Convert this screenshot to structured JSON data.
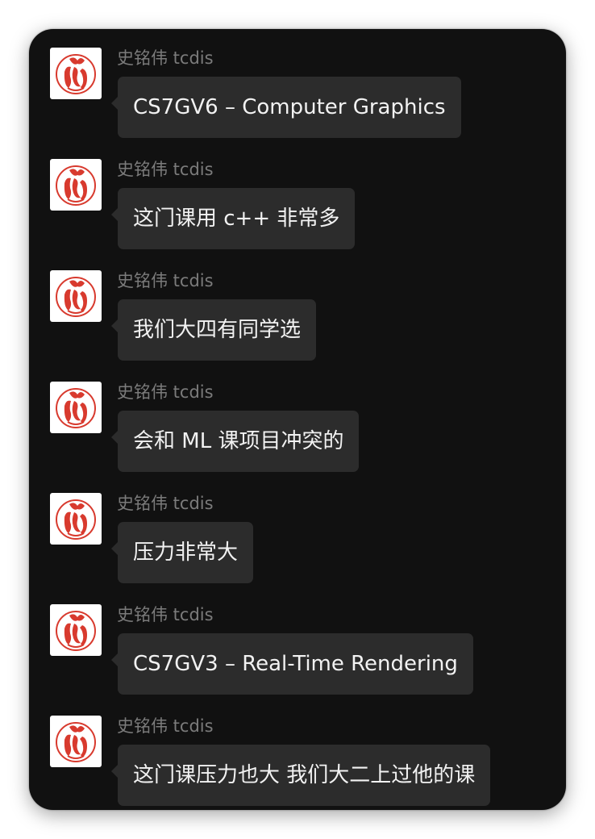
{
  "chat": {
    "messages": [
      {
        "sender": "史铭伟 tcdis",
        "text": "CS7GV6 – Computer Graphics",
        "avatar_icon": "red-stamp-seal-icon"
      },
      {
        "sender": "史铭伟 tcdis",
        "text": "这门课用 c++ 非常多",
        "avatar_icon": "red-stamp-seal-icon"
      },
      {
        "sender": "史铭伟 tcdis",
        "text": "我们大四有同学选",
        "avatar_icon": "red-stamp-seal-icon"
      },
      {
        "sender": "史铭伟 tcdis",
        "text": "会和 ML 课项目冲突的",
        "avatar_icon": "red-stamp-seal-icon"
      },
      {
        "sender": "史铭伟 tcdis",
        "text": "压力非常大",
        "avatar_icon": "red-stamp-seal-icon"
      },
      {
        "sender": "史铭伟 tcdis",
        "text": "CS7GV3 – Real-Time Rendering",
        "avatar_icon": "red-stamp-seal-icon"
      },
      {
        "sender": "史铭伟 tcdis",
        "text": "这门课压力也大 我们大二上过他的课",
        "avatar_icon": "red-stamp-seal-icon"
      }
    ]
  },
  "colors": {
    "window_background": "#111111",
    "bubble_background": "#2c2c2c",
    "message_text": "#f2f2f2",
    "sender_text": "#7b7b7b",
    "avatar_seal_red": "#d83a2e"
  }
}
